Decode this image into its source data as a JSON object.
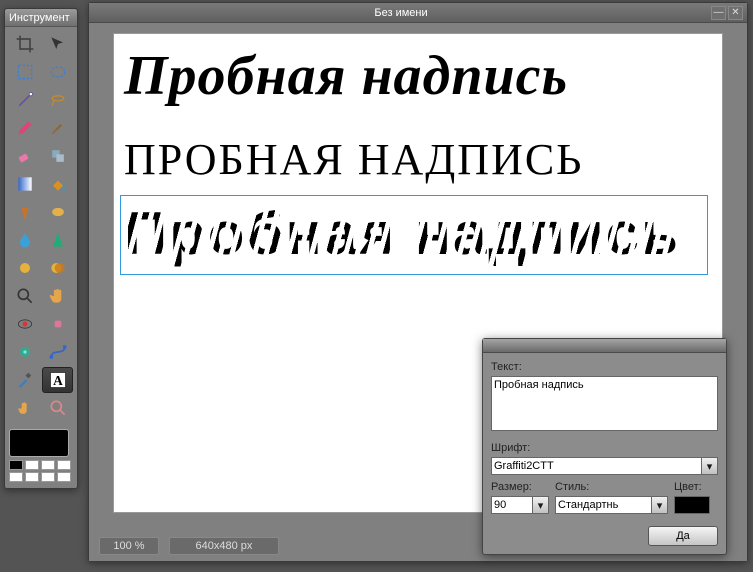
{
  "toolbox": {
    "title": "Инструмент"
  },
  "document": {
    "title": "Без имени",
    "zoom": "100 %",
    "dimensions": "640x480 px",
    "layers": {
      "line1": "Пробная  надпись",
      "line2": "ПРОБНАЯ НАДПИСЬ",
      "line3": "Пробная надпись"
    }
  },
  "dialog": {
    "text_label": "Текст:",
    "text_value": "Пробная надпись",
    "font_label": "Шрифт:",
    "font_value": "Graffiti2CTT",
    "size_label": "Размер:",
    "size_value": "90",
    "style_label": "Стиль:",
    "style_value": "Стандартнь",
    "color_label": "Цвет:",
    "color_value": "#000000",
    "ok_label": "Да"
  },
  "icons": {
    "minimize": "—",
    "close": "✕",
    "chevron_down": "▾"
  }
}
